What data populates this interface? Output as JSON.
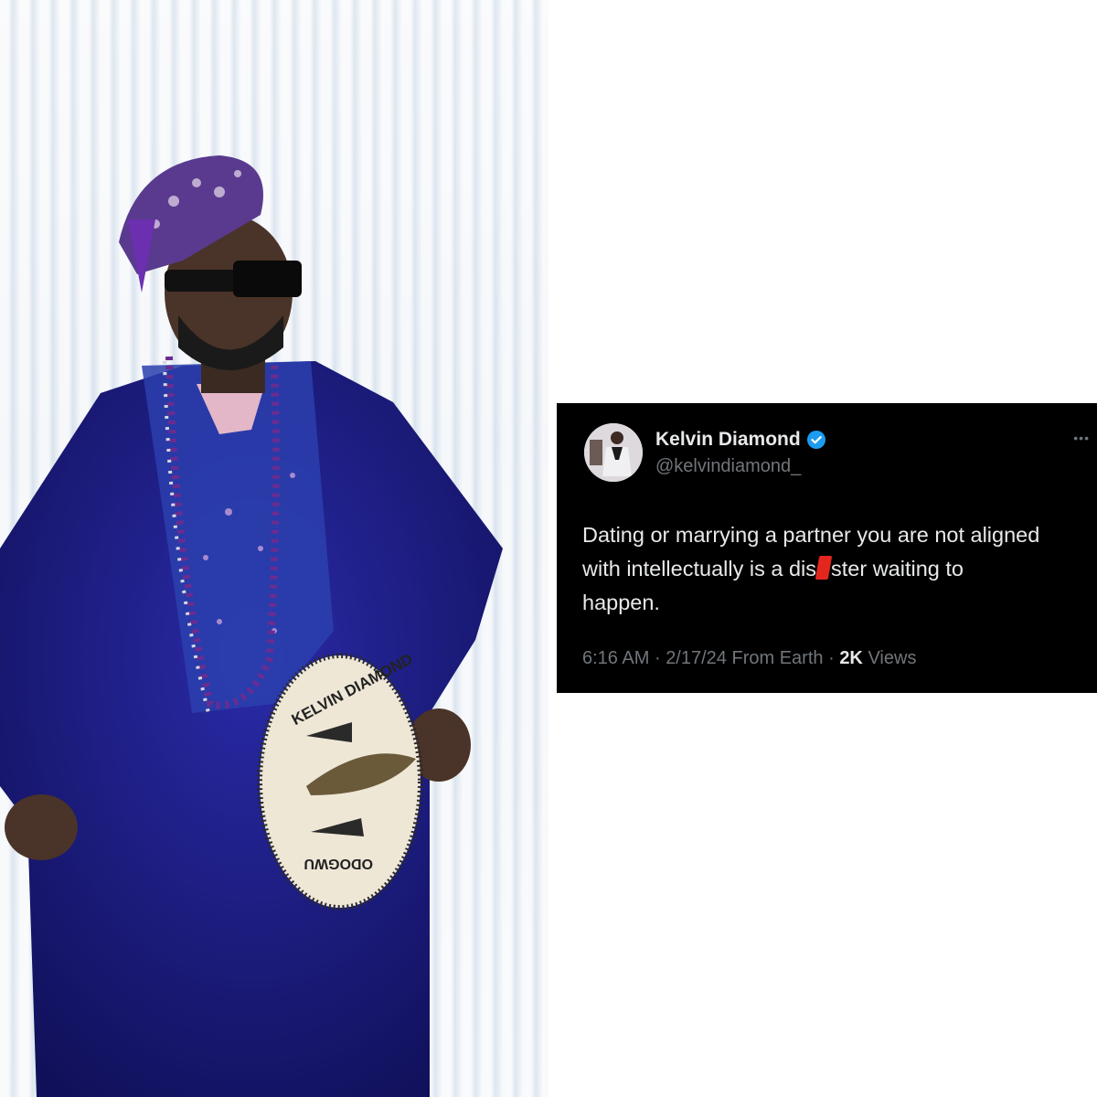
{
  "tweet": {
    "display_name": "Kelvin Diamond",
    "verified_icon": "verified-badge-icon",
    "handle": "@kelvindiamond_",
    "more_icon": "more-options-icon",
    "text_line1": "Dating or marrying a partner you are not aligned",
    "text_line2_before": "with intellectually is a dis",
    "text_line2_after": "ster waiting to",
    "text_line3": "happen.",
    "time": "6:16 AM",
    "date": "2/17/24",
    "source": "From Earth",
    "sep": "·",
    "views_count": "2K",
    "views_label": "Views"
  },
  "photo": {
    "fan_text_top": "KELVIN DIAMOND",
    "fan_text_bottom": "ODOGWU"
  },
  "colors": {
    "tweet_bg": "#000000",
    "text_primary": "#e7e9ea",
    "text_secondary": "#71767b",
    "verified_blue": "#1d9bf0",
    "agbada_blue": "#1e1e8c",
    "redaction_red": "#e3261e"
  }
}
